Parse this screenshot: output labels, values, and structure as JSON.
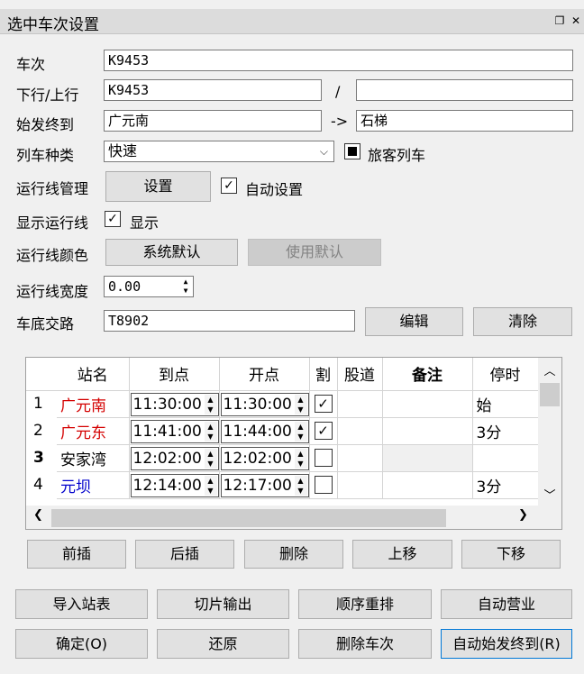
{
  "window": {
    "title": "选中车次设置",
    "restore_icon": "❐",
    "close_icon": "✕"
  },
  "fields": {
    "train_label": "车次",
    "train_value": "K9453",
    "dir_label": "下行/上行",
    "down_value": "K9453",
    "slash": "/",
    "up_value": "",
    "route_label": "始发终到",
    "origin_value": "广元南",
    "arrow": "->",
    "dest_value": "石梯",
    "type_label": "列车种类",
    "type_value": "快速",
    "passenger_label": "旅客列车",
    "line_mgmt_label": "运行线管理",
    "setup_button": "设置",
    "auto_set_label": "自动设置",
    "show_line_label": "显示运行线",
    "show_label": "显示",
    "line_color_label": "运行线颜色",
    "system_default_button": "系统默认",
    "use_default_button": "使用默认",
    "line_width_label": "运行线宽度",
    "line_width_value": "0.00",
    "chassis_label": "车底交路",
    "chassis_value": "T8902",
    "edit_button": "编辑",
    "clear_button": "清除"
  },
  "table": {
    "headers": {
      "station": "站名",
      "arrive": "到点",
      "depart": "开点",
      "check": "割",
      "track": "股道",
      "note": "备注",
      "stop": "停时"
    },
    "rows": [
      {
        "num": "1",
        "station": "广元南",
        "arrive": "11:30:00",
        "depart": "11:30:00",
        "checked": "✓",
        "track": "",
        "note": "",
        "stop": "始"
      },
      {
        "num": "2",
        "station": "广元东",
        "arrive": "11:41:00",
        "depart": "11:44:00",
        "checked": "✓",
        "track": "",
        "note": "",
        "stop": "3分"
      },
      {
        "num": "3",
        "station": "安家湾",
        "arrive": "12:02:00",
        "depart": "12:02:00",
        "checked": "",
        "track": "",
        "note": "",
        "stop": ""
      },
      {
        "num": "4",
        "station": "元坝",
        "arrive": "12:14:00",
        "depart": "12:17:00",
        "checked": "",
        "track": "",
        "note": "",
        "stop": "3分"
      }
    ]
  },
  "row_buttons": {
    "insert_before": "前插",
    "insert_after": "后插",
    "delete": "删除",
    "move_up": "上移",
    "move_down": "下移"
  },
  "bottom_buttons": {
    "import": "导入站表",
    "slice_output": "切片输出",
    "reorder": "顺序重排",
    "auto_business": "自动营业",
    "ok": "确定(O)",
    "restore": "还原",
    "delete_train": "删除车次",
    "auto_route": "自动始发终到(R)"
  },
  "colors": {
    "red_station": "#d40000",
    "blue_station": "#0000cc"
  }
}
